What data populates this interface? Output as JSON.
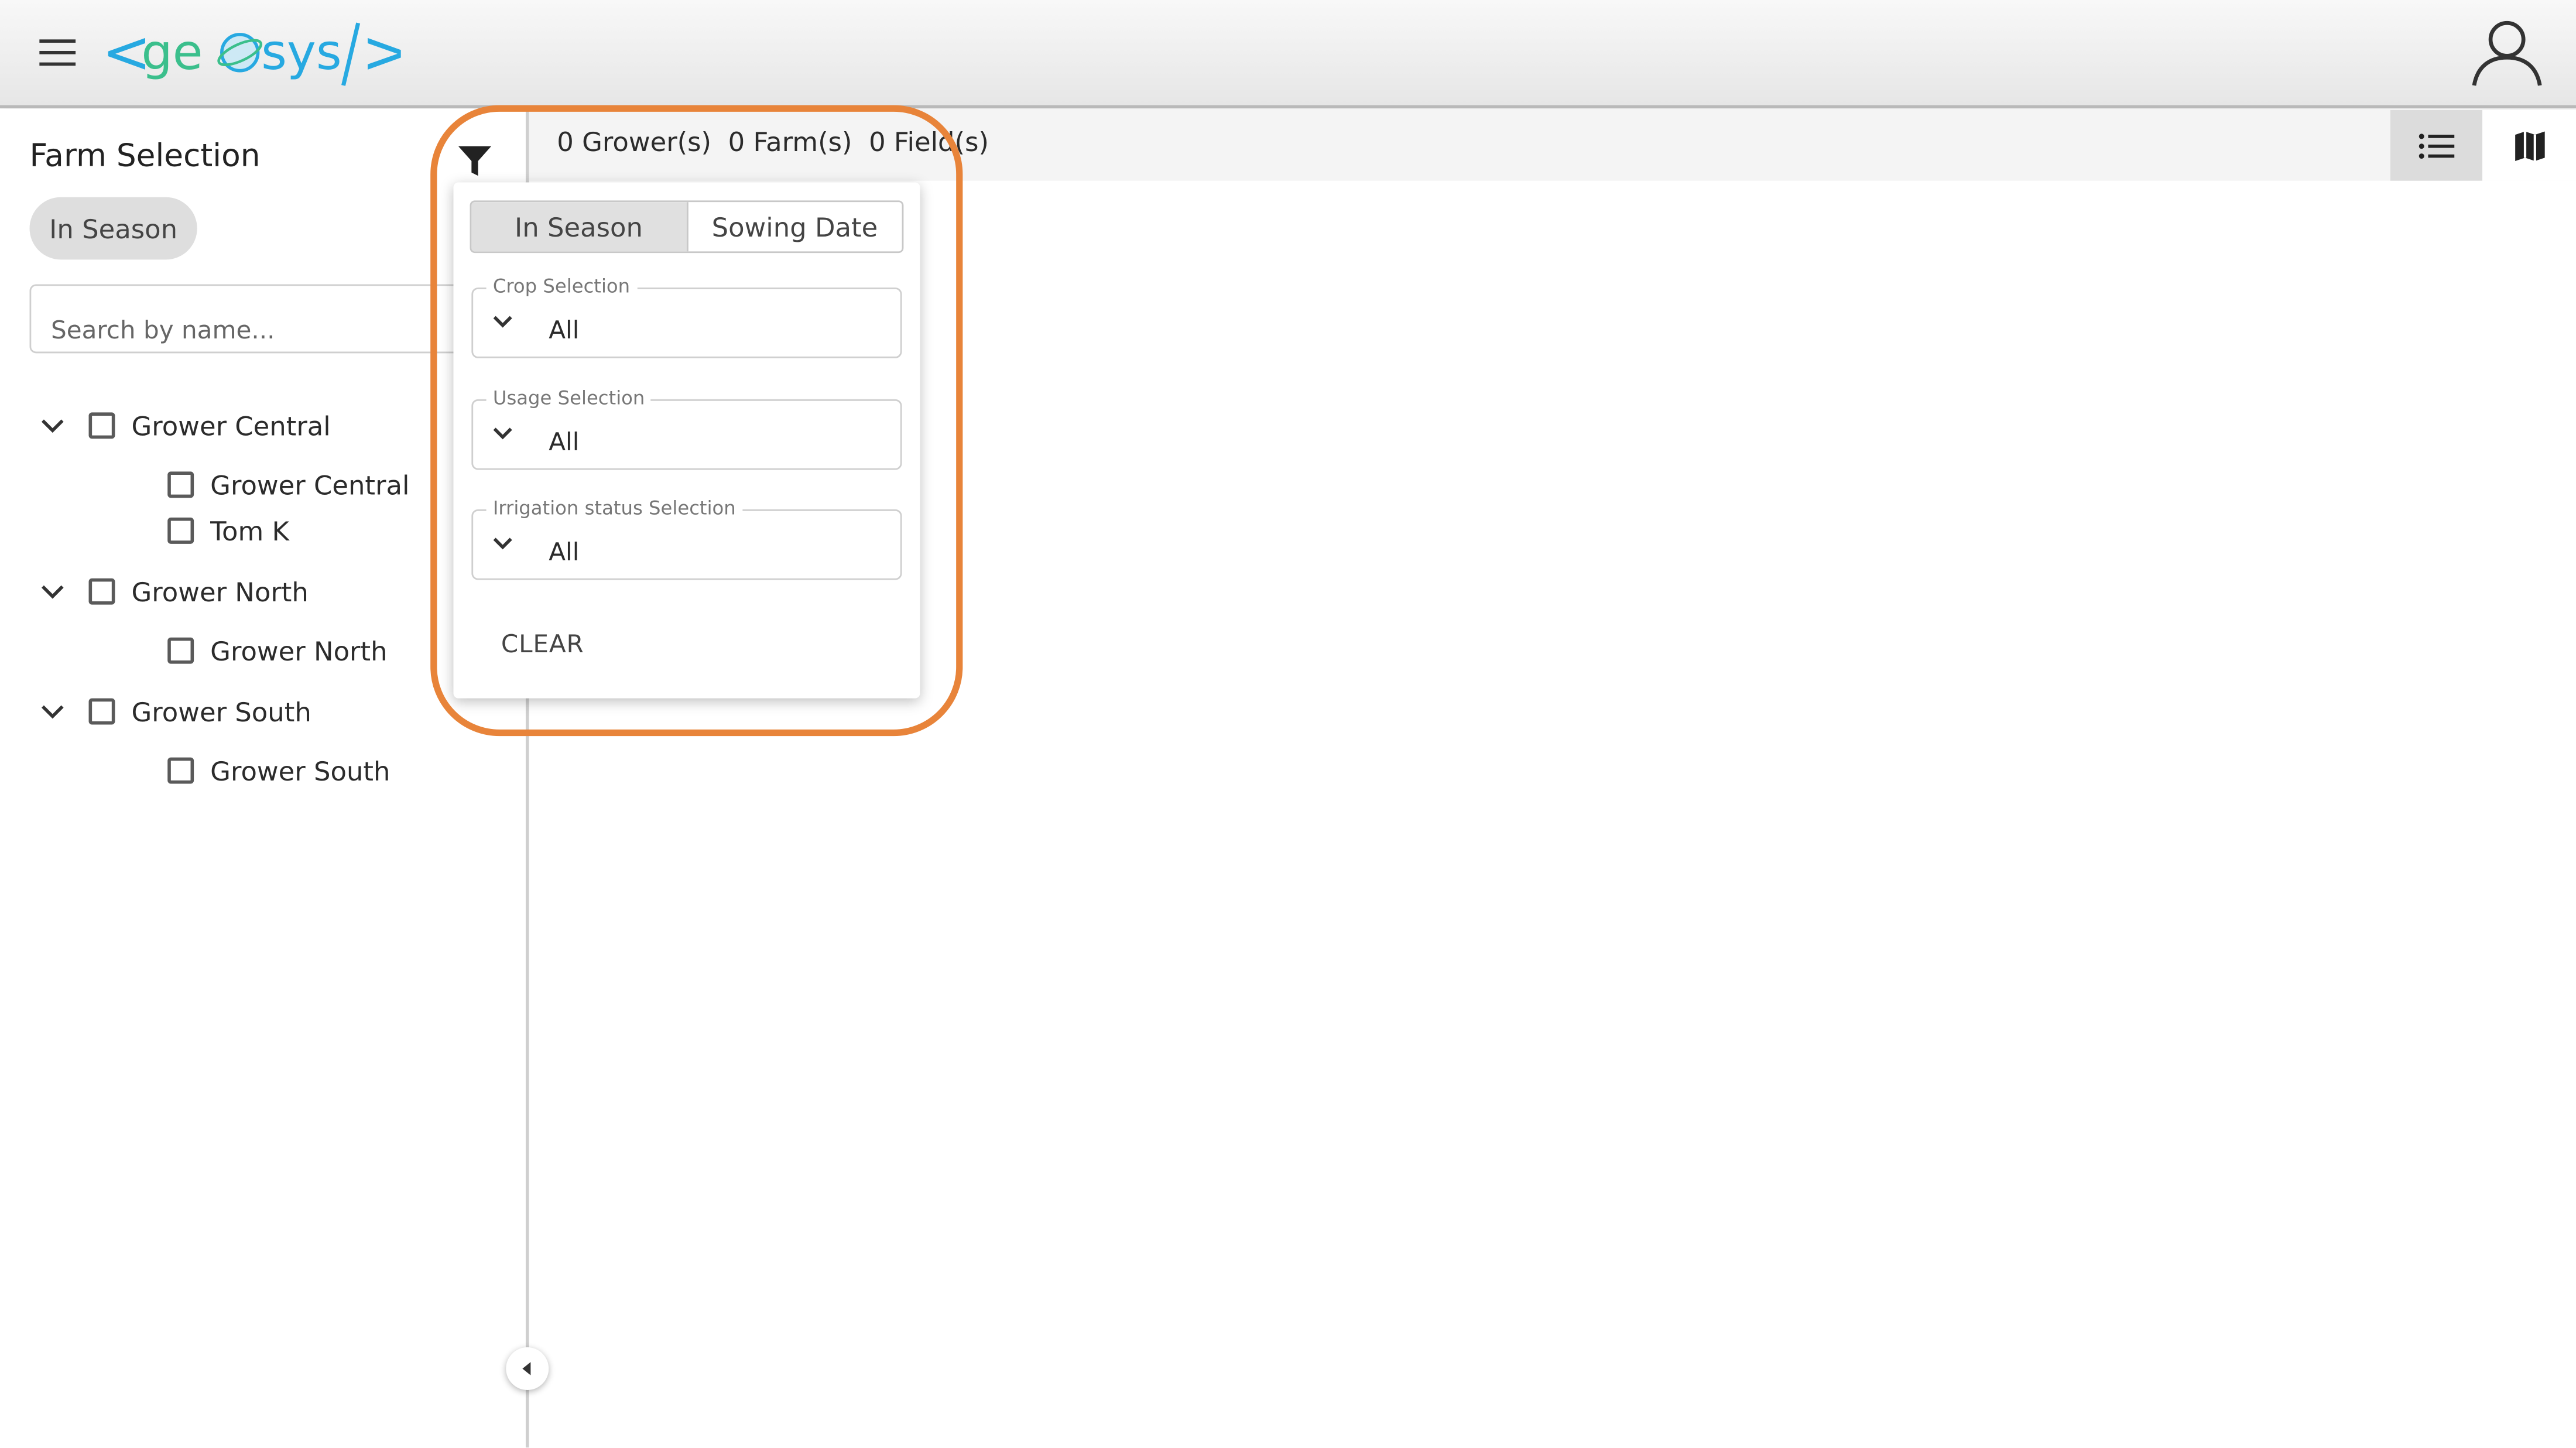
{
  "app": {
    "logo_text": "<geosys/>",
    "brand_colors": {
      "bracket": "#27a9e1",
      "text": "#3bbf8c"
    }
  },
  "header": {
    "menu_icon": "hamburger-icon",
    "user_icon": "user-icon"
  },
  "sidebar": {
    "title": "Farm Selection",
    "chip_label": "In Season",
    "search_placeholder": "Search by name...",
    "filter_icon": "filter-icon",
    "groups": [
      {
        "label": "Grower Central",
        "children": [
          "Grower Central",
          "Tom K"
        ]
      },
      {
        "label": "Grower North",
        "children": [
          "Grower North"
        ]
      },
      {
        "label": "Grower South",
        "children": [
          "Grower South"
        ]
      }
    ]
  },
  "counts": {
    "growers": "0 Grower(s)",
    "farms": "0 Farm(s)",
    "fields": "0 Field(s)"
  },
  "view_toggle": {
    "list_icon": "list-view-icon",
    "map_icon": "map-view-icon",
    "active": "list"
  },
  "filter_popover": {
    "tabs": [
      "In Season",
      "Sowing Date"
    ],
    "active_tab": "In Season",
    "crop": {
      "label": "Crop Selection",
      "value": "All"
    },
    "usage": {
      "label": "Usage Selection",
      "value": "All"
    },
    "irrigation": {
      "label": "Irrigation status Selection",
      "value": "All"
    },
    "clear_label": "CLEAR",
    "highlight_color": "#e8843a"
  }
}
